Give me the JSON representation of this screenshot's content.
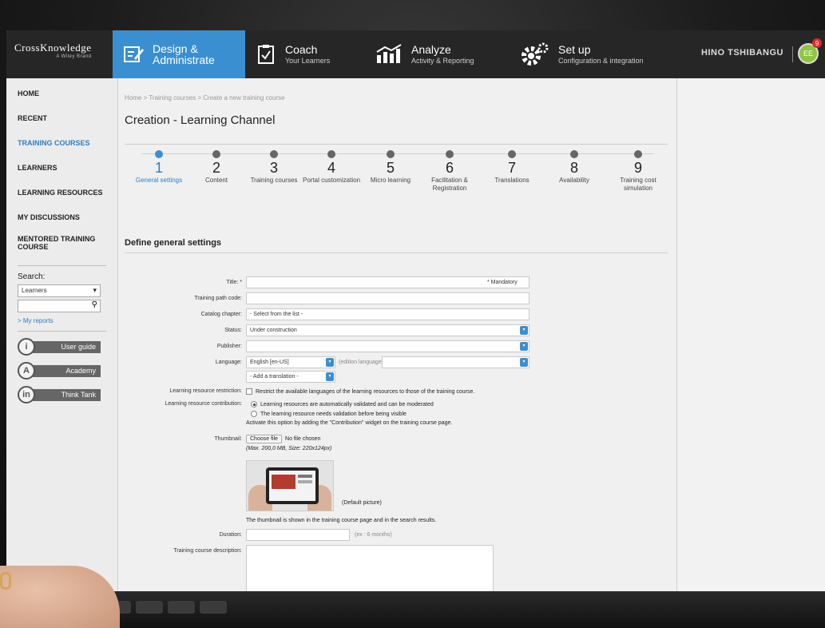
{
  "topbar": {
    "logo": "CrossKnowledge",
    "logo_sub": "A Wiley Brand",
    "nav": [
      {
        "title": "Design &",
        "title2": "Administrate",
        "sub": "",
        "icon": "edit-icon"
      },
      {
        "title": "Coach",
        "title2": "",
        "sub": "Your Learners",
        "icon": "checklist-icon"
      },
      {
        "title": "Analyze",
        "title2": "",
        "sub": "Activity & Reporting",
        "icon": "chart-icon"
      },
      {
        "title": "Set up",
        "title2": "",
        "sub": "Configuration & integration",
        "icon": "gear-icon"
      }
    ],
    "user_name": "HINO TSHIBANGU",
    "avatar_initials": "EE",
    "notifications": "9"
  },
  "sidebar": {
    "links": [
      "HOME",
      "RECENT",
      "TRAINING COURSES",
      "LEARNERS",
      "LEARNING RESOURCES",
      "MY DISCUSSIONS",
      "MENTORED TRAINING COURSE"
    ],
    "search_label": "Search:",
    "search_scope": "Learners",
    "my_reports": "> My reports",
    "buttons": [
      {
        "letter": "i",
        "label": "User guide"
      },
      {
        "letter": "A",
        "label": "Academy"
      },
      {
        "letter": "in",
        "label": "Think Tank"
      }
    ]
  },
  "main": {
    "breadcrumb": "Home > Training courses > Create a new training course",
    "title": "Creation - Learning Channel",
    "steps": [
      {
        "num": "1",
        "label": "General settings"
      },
      {
        "num": "2",
        "label": "Content"
      },
      {
        "num": "3",
        "label": "Training courses"
      },
      {
        "num": "4",
        "label": "Portal customization"
      },
      {
        "num": "5",
        "label": "Micro learning"
      },
      {
        "num": "6",
        "label": "Facilitation & Registration"
      },
      {
        "num": "7",
        "label": "Translations"
      },
      {
        "num": "8",
        "label": "Availability"
      },
      {
        "num": "9",
        "label": "Training cost simulation"
      }
    ],
    "section_title": "Define general settings",
    "form": {
      "title_label": "Title: *",
      "mandatory": "* Mandatory",
      "code_label": "Training path code:",
      "chapter_label": "Catalog chapter:",
      "chapter_value": "- Select from the list -",
      "status_label": "Status:",
      "status_value": "Under construction",
      "publisher_label": "Publisher:",
      "language_label": "Language:",
      "language_value": "English [en-US]",
      "language_hint": "(edition language)",
      "add_translation": "- Add a translation -",
      "restriction_label": "Learning resource restriction:",
      "restriction_text": "Restrict the available languages of the learning resources to those of the training course.",
      "contribution_label": "Learning resource contribution:",
      "contribution_opt1": "Learning resources are automatically validated and can be moderated",
      "contribution_opt2": "The learning resource needs validation before being visible",
      "contribution_note": "Activate this option by adding the \"Contribution\" widget on the training course page.",
      "thumbnail_label": "Thumbnail:",
      "choose_file": "Choose file",
      "no_file": "No file chosen",
      "file_limits": "(Max. 200,0 MB, Size: 220x124px)",
      "default_picture": "(Default picture)",
      "thumbnail_note": "The thumbnail is shown in the training course page and in the search results.",
      "duration_label": "Duration:",
      "duration_hint": "(ex : 6 months)",
      "description_label": "Training course description:"
    }
  }
}
